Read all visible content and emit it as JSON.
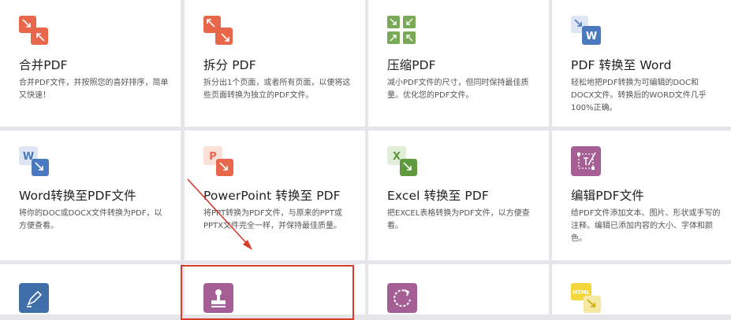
{
  "colors": {
    "orange": "#e8674a",
    "green": "#7aa957",
    "blue": "#4a79c0",
    "purple": "#a55f95",
    "yellow": "#f2d63a",
    "highlight": "#d83a2c"
  },
  "tools": [
    {
      "title": "合并PDF",
      "desc": "合并PDF文件，并按照您的喜好排序，简单又快速！",
      "icon": "merge-pdf-icon"
    },
    {
      "title": "拆分 PDF",
      "desc": "拆分出1个页面，或者所有页面，以便将这些页面转换为独立的PDF文件。",
      "icon": "split-pdf-icon"
    },
    {
      "title": "压缩PDF",
      "desc": "减小PDF文件的尺寸，但同时保持最佳质量。优化您的PDF文件。",
      "icon": "compress-pdf-icon"
    },
    {
      "title": "PDF 转换至 Word",
      "desc": "轻松地把PDF转换为可编辑的DOC和DOCX文件。转换后的WORD文件几乎100%正确。",
      "icon": "pdf-to-word-icon",
      "icon_letter": "W"
    },
    {
      "title": "Word转换至PDF文件",
      "desc": "将你的DOC或DOCX文件转换为PDF，以方便查看。",
      "icon": "word-to-pdf-icon",
      "icon_letter": "W"
    },
    {
      "title": "PowerPoint 转换至 PDF",
      "desc": "将PPT转换为PDF文件，与原来的PPT或PPTX文件完全一样，并保持最佳质量。",
      "icon": "powerpoint-to-pdf-icon",
      "icon_letter": "P"
    },
    {
      "title": "Excel 转换至 PDF",
      "desc": "把EXCEL表格转换为PDF文件，以方便查看。",
      "icon": "excel-to-pdf-icon",
      "icon_letter": "X"
    },
    {
      "title": "编辑PDF文件",
      "desc": "给PDF文件添加文本、图片、形状或手写的注释。编辑已添加内容的大小、字体和颜色。",
      "icon": "edit-pdf-icon"
    },
    {
      "title": "",
      "desc": "",
      "icon": "sign-pdf-icon"
    },
    {
      "title": "",
      "desc": "",
      "icon": "stamp-pdf-icon"
    },
    {
      "title": "",
      "desc": "",
      "icon": "rotate-pdf-icon"
    },
    {
      "title": "",
      "desc": "",
      "icon": "html-to-pdf-icon",
      "icon_letter": "HTML"
    }
  ]
}
